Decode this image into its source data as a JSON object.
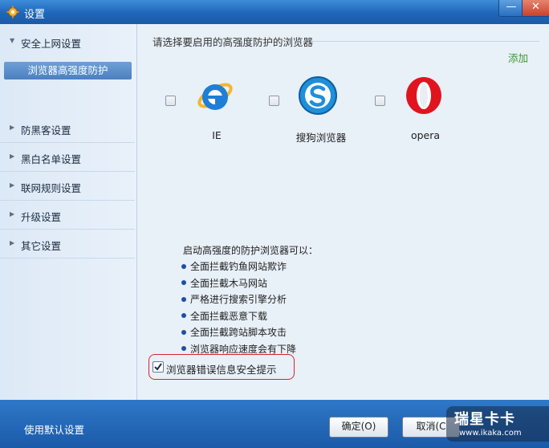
{
  "window": {
    "title": "设置",
    "minimize_glyph": "—",
    "close_glyph": "✕"
  },
  "sidebar": {
    "groups": [
      {
        "label": "安全上网设置",
        "expanded": true
      },
      {
        "label": "防黑客设置",
        "expanded": false
      },
      {
        "label": "黑白名单设置",
        "expanded": false
      },
      {
        "label": "联网规则设置",
        "expanded": false
      },
      {
        "label": "升级设置",
        "expanded": false
      },
      {
        "label": "其它设置",
        "expanded": false
      }
    ],
    "selected_sub": "浏览器高强度防护"
  },
  "content": {
    "section_heading": "请选择要启用的高强度防护的浏览器",
    "add_link": "添加",
    "browsers": [
      {
        "name": "IE",
        "icon": "ie-icon",
        "checked": false
      },
      {
        "name": "搜狗浏览器",
        "icon": "sogou-icon",
        "checked": false
      },
      {
        "name": "opera",
        "icon": "opera-icon",
        "checked": false
      }
    ],
    "info_title": "启动高强度的防护浏览器可以：",
    "info_items": [
      "全面拦截钓鱼网站欺诈",
      "全面拦截木马网站",
      "严格进行搜索引擎分析",
      "全面拦截恶意下载",
      "全面拦截跨站脚本攻击",
      "浏览器响应速度会有下降"
    ],
    "error_prompt": {
      "label": "浏览器错误信息安全提示",
      "checked": true
    }
  },
  "footer": {
    "default_settings": "使用默认设置",
    "ok_label": "确定(O)",
    "cancel_label": "取消(C",
    "watermark_brand": "瑞星卡卡",
    "watermark_url": "www.ikaka.com"
  },
  "colors": {
    "titlebar": "#1f66b8",
    "accent_green": "#3a9a2c",
    "highlight_red": "#d9252b",
    "sidebar_selected": "#4b80c0"
  }
}
